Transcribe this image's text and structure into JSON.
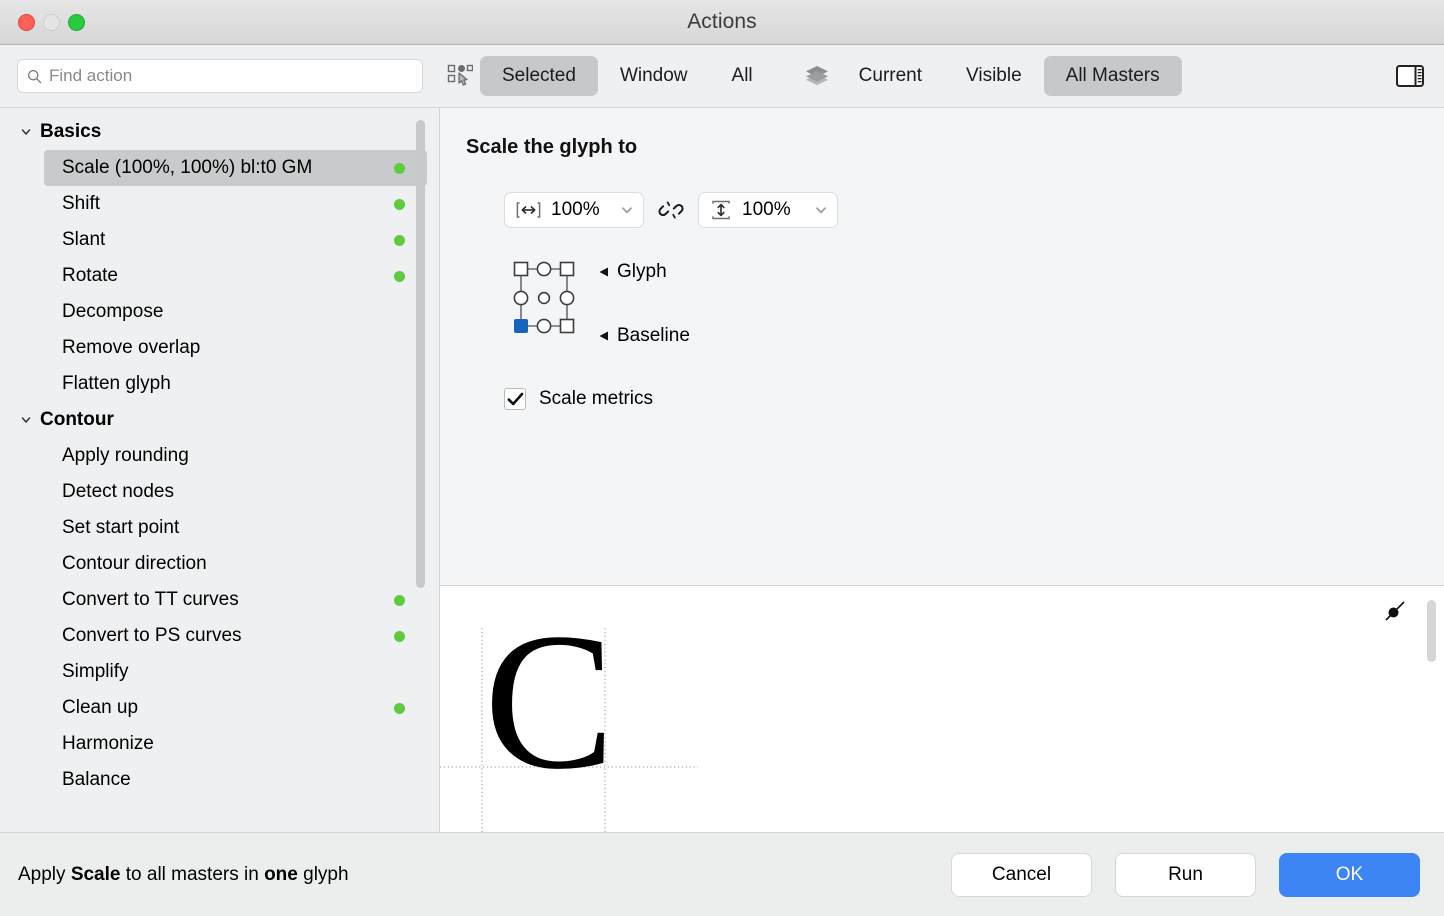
{
  "window": {
    "title": "Actions",
    "traffic_lights": [
      "close-button",
      "minimize-button",
      "maximize-button"
    ]
  },
  "search": {
    "placeholder": "Find action",
    "value": "",
    "icon": "search-icon"
  },
  "toolbar": {
    "scope_icon": "select-glyphs-icon",
    "scope_segments": [
      {
        "label": "Selected",
        "active": true
      },
      {
        "label": "Window",
        "active": false
      },
      {
        "label": "All",
        "active": false
      }
    ],
    "masters_icon": "layers-icon",
    "masters_segments": [
      {
        "label": "Current",
        "active": false
      },
      {
        "label": "Visible",
        "active": false
      },
      {
        "label": "All Masters",
        "active": true
      }
    ],
    "panel_toggle_icon": "sidebar-toggle-icon"
  },
  "sidebar": {
    "groups": [
      {
        "title": "Basics",
        "expanded": true,
        "items": [
          {
            "label": "Scale (100%, 100%) bl:t0 GM",
            "selected": true,
            "dot": true
          },
          {
            "label": "Shift",
            "selected": false,
            "dot": true
          },
          {
            "label": "Slant",
            "selected": false,
            "dot": true
          },
          {
            "label": "Rotate",
            "selected": false,
            "dot": true
          },
          {
            "label": "Decompose",
            "selected": false,
            "dot": false
          },
          {
            "label": "Remove overlap",
            "selected": false,
            "dot": false
          },
          {
            "label": "Flatten glyph",
            "selected": false,
            "dot": false
          }
        ]
      },
      {
        "title": "Contour",
        "expanded": true,
        "items": [
          {
            "label": "Apply rounding",
            "selected": false,
            "dot": false
          },
          {
            "label": "Detect nodes",
            "selected": false,
            "dot": false
          },
          {
            "label": "Set start point",
            "selected": false,
            "dot": false
          },
          {
            "label": "Contour direction",
            "selected": false,
            "dot": false
          },
          {
            "label": "Convert to TT curves",
            "selected": false,
            "dot": true
          },
          {
            "label": "Convert to PS curves",
            "selected": false,
            "dot": true
          },
          {
            "label": "Simplify",
            "selected": false,
            "dot": false
          },
          {
            "label": "Clean up",
            "selected": false,
            "dot": true
          },
          {
            "label": "Harmonize",
            "selected": false,
            "dot": false
          },
          {
            "label": "Balance",
            "selected": false,
            "dot": false
          }
        ]
      }
    ]
  },
  "options": {
    "title": "Scale the glyph to",
    "width_field": {
      "icon": "horizontal-size-icon",
      "value": "100%"
    },
    "link_icon": "broken-link-icon",
    "height_field": {
      "icon": "vertical-size-icon",
      "value": "100%"
    },
    "anchor": {
      "glyph_label": "Glyph",
      "baseline_label": "Baseline",
      "selected": "bottom-left"
    },
    "scale_metrics": {
      "label": "Scale metrics",
      "checked": true
    }
  },
  "preview": {
    "glyph": "C",
    "node_icon": "bezier-node-icon"
  },
  "footer": {
    "note_prefix": "Apply ",
    "note_action": "Scale",
    "note_middle": " to all masters in ",
    "note_count": "one",
    "note_suffix": " glyph",
    "buttons": [
      {
        "label": "Cancel",
        "primary": false
      },
      {
        "label": "Run",
        "primary": false
      },
      {
        "label": "OK",
        "primary": true
      }
    ]
  },
  "colors": {
    "accent": "#3d84f5",
    "status_dot": "#5fcb3c",
    "selection": "#c8cacb",
    "anchor_selected": "#1565c0"
  }
}
